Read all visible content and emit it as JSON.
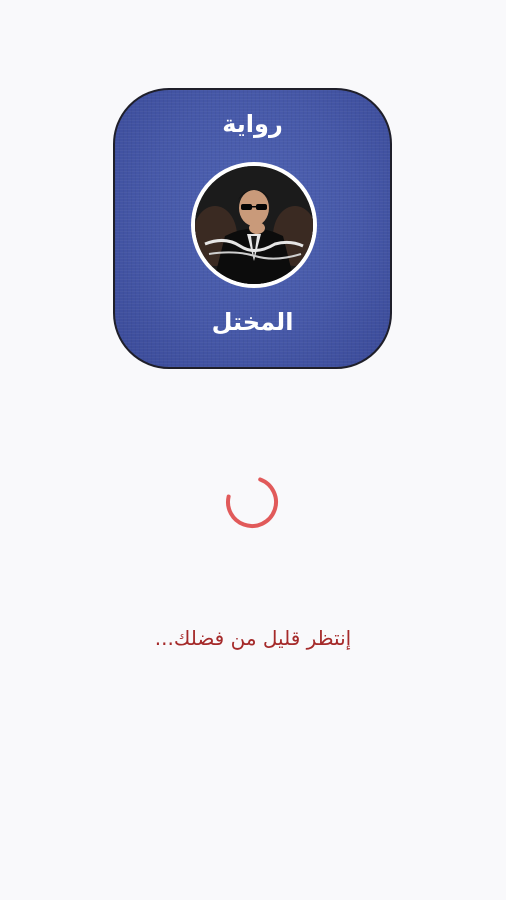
{
  "app_icon": {
    "title_top": "رواية",
    "title_bottom": "المختل",
    "portrait_label": "portrait-image",
    "background_color": "#4658a8"
  },
  "loading": {
    "spinner_color": "#e15a5a",
    "message": "إنتظر قليل من فضلك..."
  },
  "colors": {
    "page_background": "#f9f9fb",
    "message_color": "#a52a2a"
  }
}
